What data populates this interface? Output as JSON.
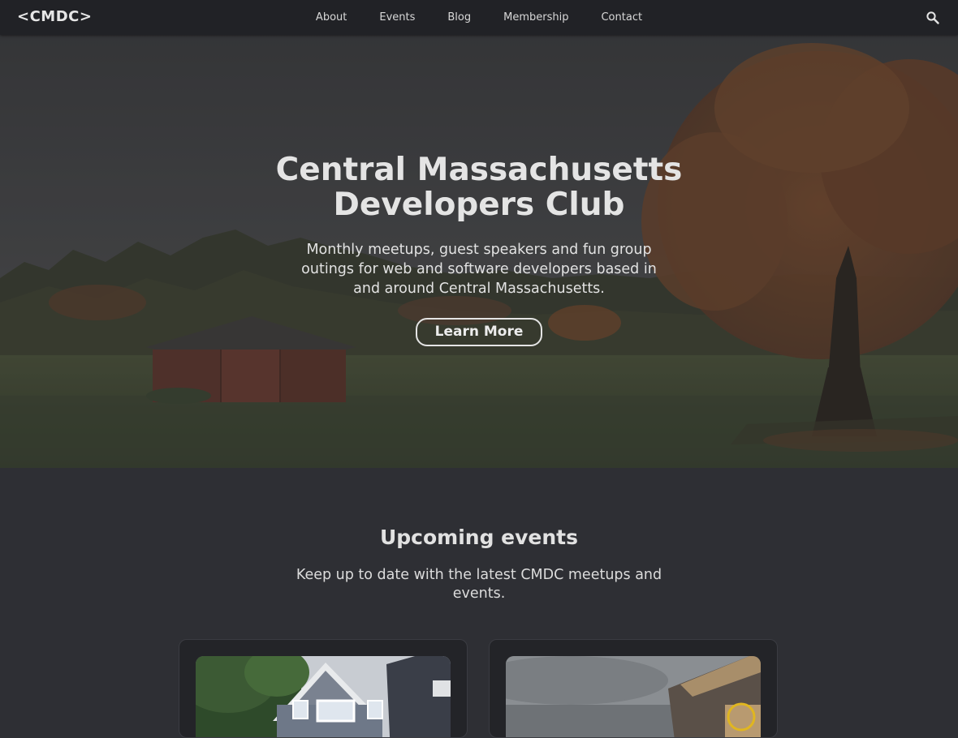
{
  "nav": {
    "logo": "<CMDC>",
    "links": [
      "About",
      "Events",
      "Blog",
      "Membership",
      "Contact"
    ],
    "search_icon": "search-icon"
  },
  "hero": {
    "title": "Central Massachusetts Developers Club",
    "subtitle": "Monthly meetups, guest speakers and fun group outings for web and software developers based in and around Central Massachusetts.",
    "button_label": "Learn More"
  },
  "events": {
    "title": "Upcoming events",
    "subtitle": "Keep up to date with the latest CMDC meetups and events."
  },
  "colors": {
    "nav_bg": "#212226",
    "page_bg": "#2e2f34",
    "card_bg": "#232428",
    "text": "#e2e2e2"
  }
}
